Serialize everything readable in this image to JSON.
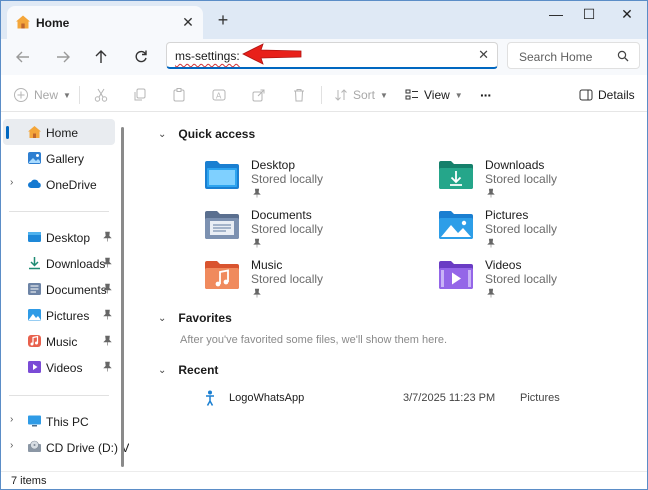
{
  "tab": {
    "title": "Home",
    "close": "✕",
    "new_tab": "+"
  },
  "window_controls": {
    "minimize": "—",
    "maximize": "☐",
    "close": "✕"
  },
  "address_bar": {
    "value": "ms-settings:",
    "clear": "✕"
  },
  "search": {
    "placeholder": "Search Home"
  },
  "toolbar": {
    "new_label": "New",
    "sort_label": "Sort",
    "view_label": "View",
    "more_label": "···",
    "details_label": "Details"
  },
  "sidebar": {
    "items": [
      {
        "label": "Home",
        "icon": "home-icon"
      },
      {
        "label": "Gallery",
        "icon": "gallery-icon"
      },
      {
        "label": "OneDrive",
        "icon": "cloud-icon"
      },
      {
        "label": "Desktop",
        "icon": "desktop-folder-icon"
      },
      {
        "label": "Downloads",
        "icon": "download-icon"
      },
      {
        "label": "Documents",
        "icon": "documents-icon"
      },
      {
        "label": "Pictures",
        "icon": "pictures-icon"
      },
      {
        "label": "Music",
        "icon": "music-icon"
      },
      {
        "label": "Videos",
        "icon": "videos-icon"
      },
      {
        "label": "This PC",
        "icon": "pc-icon"
      },
      {
        "label": "CD Drive (D:) Vir",
        "icon": "cd-drive-icon"
      }
    ]
  },
  "sections": {
    "quick_access": "Quick access",
    "favorites": "Favorites",
    "favorites_empty": "After you've favorited some files, we'll show them here.",
    "recent": "Recent"
  },
  "quick_access": [
    {
      "name": "Desktop",
      "sub": "Stored locally",
      "icon": "desktop-folder-icon"
    },
    {
      "name": "Downloads",
      "sub": "Stored locally",
      "icon": "downloads-folder-icon"
    },
    {
      "name": "Documents",
      "sub": "Stored locally",
      "icon": "documents-folder-icon"
    },
    {
      "name": "Pictures",
      "sub": "Stored locally",
      "icon": "pictures-folder-icon"
    },
    {
      "name": "Music",
      "sub": "Stored locally",
      "icon": "music-folder-icon"
    },
    {
      "name": "Videos",
      "sub": "Stored locally",
      "icon": "videos-folder-icon"
    }
  ],
  "recent": [
    {
      "name": "LogoWhatsApp",
      "date": "3/7/2025 11:23 PM",
      "location": "Pictures"
    }
  ],
  "status": {
    "items": "7 items"
  },
  "colors": {
    "accent": "#0067c0",
    "annotation_arrow": "#e8201a"
  }
}
